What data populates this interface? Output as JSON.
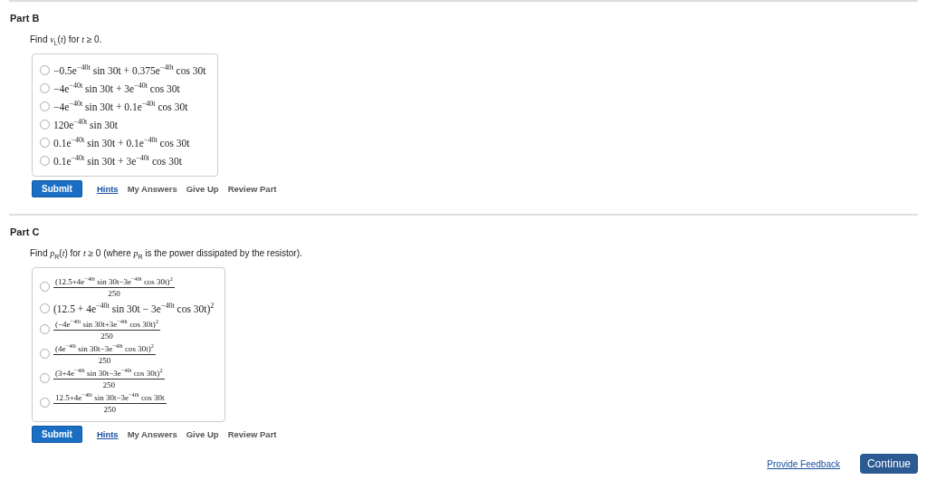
{
  "parts": [
    {
      "title": "Part B",
      "prompt": "Find *v*$_{L}$(*t*) for *t* ≥ 0.",
      "options": [
        {
          "kind": "inline",
          "selected": false,
          "text": "−0.5e$^{−40t}$ sin 30t + 0.375e$^{−40t}$ cos 30t"
        },
        {
          "kind": "inline",
          "selected": false,
          "text": "−4e$^{−40t}$ sin 30t + 3e$^{−40t}$ cos 30t"
        },
        {
          "kind": "inline",
          "selected": false,
          "text": "−4e$^{−40t}$ sin 30t + 0.1e$^{−40t}$ cos 30t"
        },
        {
          "kind": "inline",
          "selected": false,
          "text": "120e$^{−40t}$ sin 30t"
        },
        {
          "kind": "inline",
          "selected": false,
          "text": "0.1e$^{−40t}$ sin 30t + 0.1e$^{−40t}$ cos 30t"
        },
        {
          "kind": "inline",
          "selected": false,
          "text": "0.1e$^{−40t}$ sin 30t + 3e$^{−40t}$ cos 30t"
        }
      ],
      "actions": {
        "submit": "Submit",
        "links": [
          "Hints",
          "My Answers",
          "Give Up",
          "Review Part"
        ]
      }
    },
    {
      "title": "Part C",
      "prompt": "Find *p*$_{R}$(*t*) for *t* ≥ 0 (where *p*$_{R}$ is the power dissipated by the resistor).",
      "options": [
        {
          "kind": "fraction",
          "selected": false,
          "numerator": "(12.5+4e$^{−40t}$ sin 30t−3e$^{−40t}$ cos 30t)$^{2}$",
          "denominator": "250"
        },
        {
          "kind": "inline",
          "selected": false,
          "text": "(12.5 + 4e$^{−40t}$ sin 30t − 3e$^{−40t}$ cos 30t)$^{2}$"
        },
        {
          "kind": "fraction",
          "selected": false,
          "numerator": "(−4e$^{−40t}$ sin 30t+3e$^{−40t}$ cos 30t)$^{2}$",
          "denominator": "250"
        },
        {
          "kind": "fraction",
          "selected": false,
          "numerator": "(4e$^{−40t}$ sin 30t−3e$^{−40t}$ cos 30t)$^{2}$",
          "denominator": "250"
        },
        {
          "kind": "fraction",
          "selected": false,
          "numerator": "(3+4e$^{−40t}$ sin 30t−3e$^{−40t}$ cos 30t)$^{2}$",
          "denominator": "250"
        },
        {
          "kind": "fraction",
          "selected": false,
          "numerator": "12.5+4e$^{−40t}$ sin 30t−3e$^{−40t}$ cos 30t",
          "denominator": "250"
        }
      ],
      "actions": {
        "submit": "Submit",
        "links": [
          "Hints",
          "My Answers",
          "Give Up",
          "Review Part"
        ]
      }
    }
  ],
  "footer": {
    "feedback": "Provide Feedback",
    "continue": "Continue"
  }
}
